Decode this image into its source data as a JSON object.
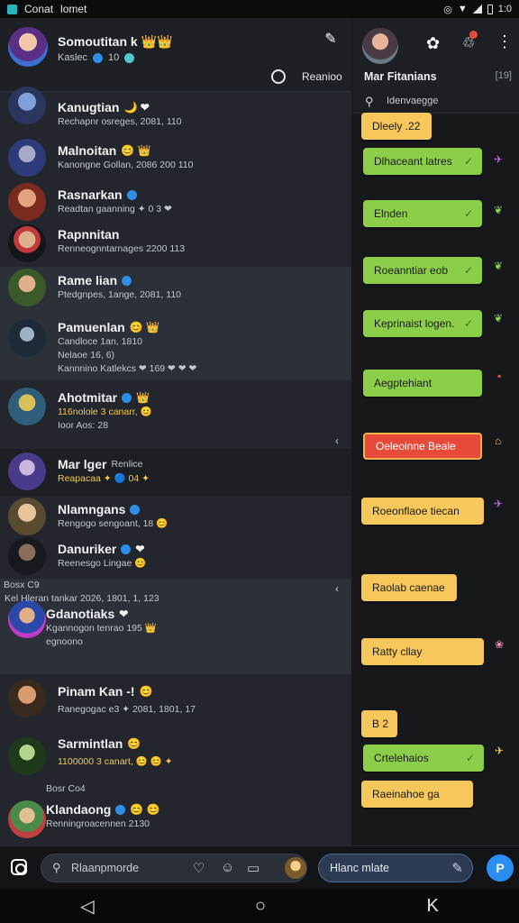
{
  "statusbar": {
    "app": "Conat",
    "title": "lomet",
    "time": "1:0",
    "icons": [
      "media-icon",
      "vibrate-icon",
      "wifi-icon",
      "signal-icon",
      "battery-icon"
    ]
  },
  "me": {
    "name": "Somoutitan k",
    "badge_emoji": "👑👑",
    "sub": "Kaslec",
    "sub2": "10"
  },
  "header": {
    "filter_label": "Reanioo"
  },
  "chats": [
    {
      "name": "Kanugtian",
      "emoji": "🌙 ❤",
      "line1": "Rechapnr osreges, 2081, 110",
      "line2": "",
      "line3": ""
    },
    {
      "name": "Malnoitan",
      "emoji": "😊 👑",
      "line1": "Kanongne Gollan, 2086 200 110",
      "line2": "",
      "line3": ""
    },
    {
      "name": "Rasnarkan",
      "emoji": "",
      "line1": "Readtan gaanning ✦ 0 3 ❤",
      "line2": "",
      "line3": ""
    },
    {
      "name": "Rapnnitan",
      "emoji": "",
      "line1": "Renneognntarnages 2200 113",
      "line2": "",
      "line3": ""
    },
    {
      "name": "Rame lian",
      "emoji": "",
      "line1": "Ptedgnpes, 1ange, 2081, 110",
      "line2": "",
      "line3": ""
    },
    {
      "name": "Pamuenlan",
      "emoji": "😊 👑",
      "line1": "Candloce 1an, 1810",
      "line2": "Nelaoe 16, 6)",
      "line3": "Kannnino Katlekcs ❤ 169 ❤ ❤ ❤"
    },
    {
      "name": "Ahotmitar",
      "emoji": "👑",
      "line1": "116nolole 3 canarr, 😊",
      "line2": "Ioor Aos: 28",
      "line3": ""
    },
    {
      "name": "Mar lger",
      "emoji": "",
      "line1": "Renlice",
      "line2": "Reapacaa ✦ 🔵 04 ✦",
      "line3": ""
    },
    {
      "name": "Nlamngans",
      "emoji": "",
      "line1": "Rengogo sengoant, 18 😊",
      "line2": "",
      "line3": ""
    },
    {
      "name": "Danuriker",
      "emoji": "❤",
      "line1": "Reenesgo Lingae 😊",
      "line2": "",
      "line3": ""
    },
    {
      "name": "Gdanotiaks",
      "emoji": "❤",
      "line1": "Kgannogon tenrao 195 👑",
      "line2": "egnoono",
      "line3": "Kel Hleran tankar 2026, 1801, 1, 123"
    },
    {
      "name": "Pinam Kan -!",
      "emoji": "😊",
      "line1": "Ranegogac e3 ✦ 2081, 1801, 17",
      "line2": "",
      "line3": ""
    },
    {
      "name": "Sarmintlan",
      "emoji": "😊",
      "line1": "1100000 3 canart, 😊 😊 ✦",
      "line2": "",
      "line3": ""
    },
    {
      "name": "Klandaong",
      "emoji": "😊 😊",
      "line1": "Renningroacennen 2130",
      "line2": "",
      "line3": ""
    }
  ],
  "section_labels": {
    "a": "Bosx C9",
    "b": "Bosr Co4"
  },
  "right": {
    "title": "Mar Fitanians",
    "title_right": "[19]",
    "search_placeholder": "Idenvaegge",
    "bubbles": [
      {
        "text": "Dleely .22",
        "color": "yellow"
      },
      {
        "text": "Dlhaceant latres",
        "color": "green"
      },
      {
        "text": "Elnden",
        "color": "green"
      },
      {
        "text": "Roeanntiar eob",
        "color": "green"
      },
      {
        "text": "Keprinaist logen.",
        "color": "green"
      },
      {
        "text": "Aegptehiant",
        "color": "green"
      },
      {
        "text": "Oeleoinne Beale",
        "color": "red"
      },
      {
        "text": "Roeonflaoe tiecan",
        "color": "yellow"
      },
      {
        "text": "Raolab caenae",
        "color": "yellow"
      },
      {
        "text": "Ratty cllay",
        "color": "yellow"
      },
      {
        "text": "B 2",
        "color": "yellow"
      },
      {
        "text": "Crtelehaios",
        "color": "green"
      },
      {
        "text": "Raeinahoe ga",
        "color": "yellow"
      }
    ]
  },
  "composer": {
    "placeholder": "Rlaanpmorde",
    "reply": "Hlanc mlate"
  },
  "colors": {
    "accent": "#2a8ff0",
    "bubble_green": "#8ccd4a",
    "bubble_yellow": "#f6c75a",
    "bubble_red": "#e84a3a"
  }
}
